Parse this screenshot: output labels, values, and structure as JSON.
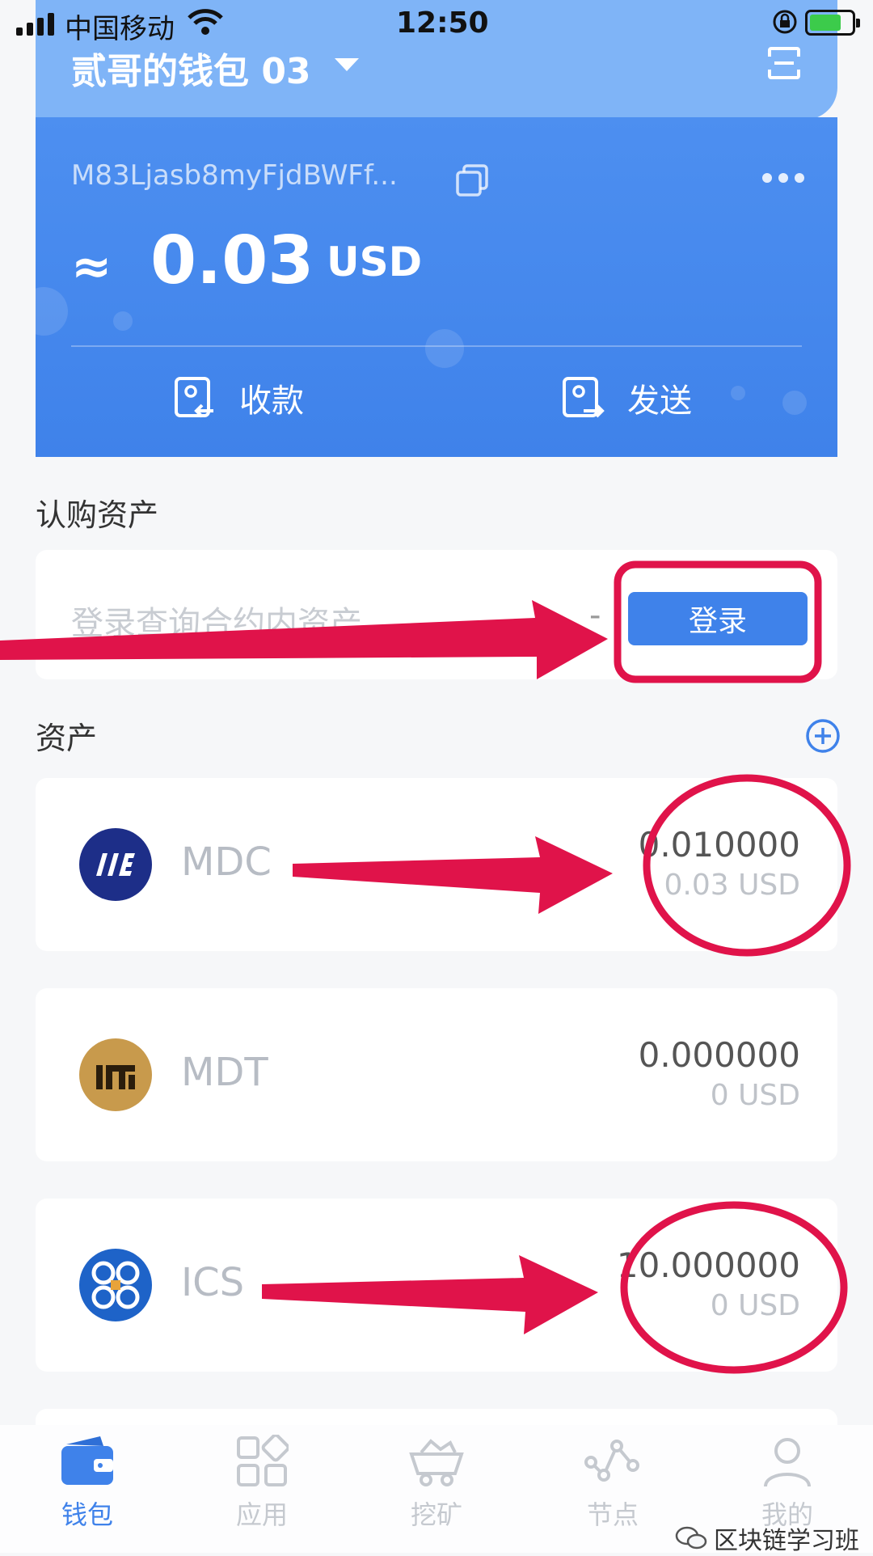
{
  "status_bar": {
    "carrier": "中国移动",
    "time": "12:50",
    "battery_level": 0.75
  },
  "wallet": {
    "name": "贰哥的钱包 03",
    "address": "M83Ljasb8myFjdBWFf...",
    "approx_symbol": "≈",
    "balance": "0.03",
    "currency": "USD",
    "receive_label": "收款",
    "send_label": "发送"
  },
  "subscription": {
    "title": "认购资产",
    "prompt": "登录查询合约内资产",
    "dash": "-",
    "login_label": "登录"
  },
  "assets_section": {
    "title": "资产"
  },
  "assets": [
    {
      "name": "MDC",
      "amount": "0.010000",
      "usd": "0.03 USD",
      "logo_color": "#1d2e88"
    },
    {
      "name": "MDT",
      "amount": "0.000000",
      "usd": "0 USD",
      "logo_color": "#c89a4c"
    },
    {
      "name": "ICS",
      "amount": "10.000000",
      "usd": "0 USD",
      "logo_color": "#1e63c8"
    }
  ],
  "nav": [
    {
      "label": "钱包",
      "icon": "wallet-icon",
      "active": true
    },
    {
      "label": "应用",
      "icon": "apps-icon",
      "active": false
    },
    {
      "label": "挖矿",
      "icon": "mining-cart-icon",
      "active": false
    },
    {
      "label": "节点",
      "icon": "node-icon",
      "active": false
    },
    {
      "label": "我的",
      "icon": "profile-icon",
      "active": false
    }
  ],
  "watermark": "区块链学习班",
  "colors": {
    "primary": "#3f82ea",
    "header_light": "#7fb4f7",
    "annotation_red": "#e0134a"
  }
}
